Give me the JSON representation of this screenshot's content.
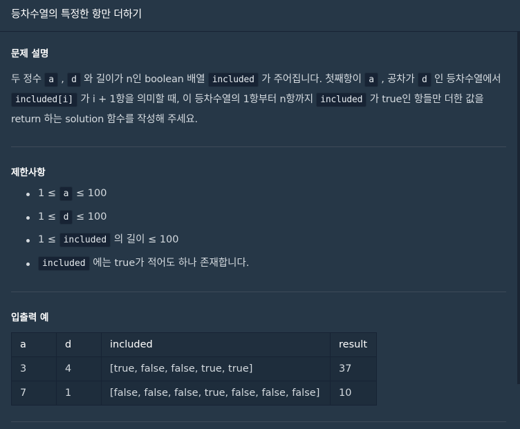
{
  "header": {
    "title": "등차수열의 특정한 항만 더하기"
  },
  "description": {
    "section_title": "문제 설명",
    "p1": "두 정수 ",
    "code_a": "a",
    "p2": " , ",
    "code_d": "d",
    "p3": " 와 길이가 n인 boolean 배열 ",
    "code_included": "included",
    "p4": " 가 주어집니다. 첫째항이 ",
    "code_a2": "a",
    "p5": " , 공차가 ",
    "code_d2": "d",
    "p6": " 인 등차수열에서 ",
    "code_included_i": "included[i]",
    "p7": " 가 i + 1항을 의미할 때, 이 등차수열의 1항부터 n항까지 ",
    "code_included2": "included",
    "p8": " 가 true인 항들만 더한 값을 return 하는 solution 함수를 작성해 주세요."
  },
  "limits": {
    "section_title": "제한사항",
    "items": [
      {
        "pre": "1 ≤ ",
        "code": "a",
        "post": " ≤ 100"
      },
      {
        "pre": "1 ≤ ",
        "code": "d",
        "post": " ≤ 100"
      },
      {
        "pre": "1 ≤ ",
        "code": "included",
        "post": " 의 길이 ≤ 100"
      },
      {
        "pre": "",
        "code": "included",
        "post": " 에는 true가 적어도 하나 존재합니다."
      }
    ]
  },
  "examples": {
    "section_title": "입출력 예",
    "columns": [
      "a",
      "d",
      "included",
      "result"
    ],
    "rows": [
      [
        "3",
        "4",
        "[true, false, false, true, true]",
        "37"
      ],
      [
        "7",
        "1",
        "[false, false, false, true, false, false, false]",
        "10"
      ]
    ]
  }
}
